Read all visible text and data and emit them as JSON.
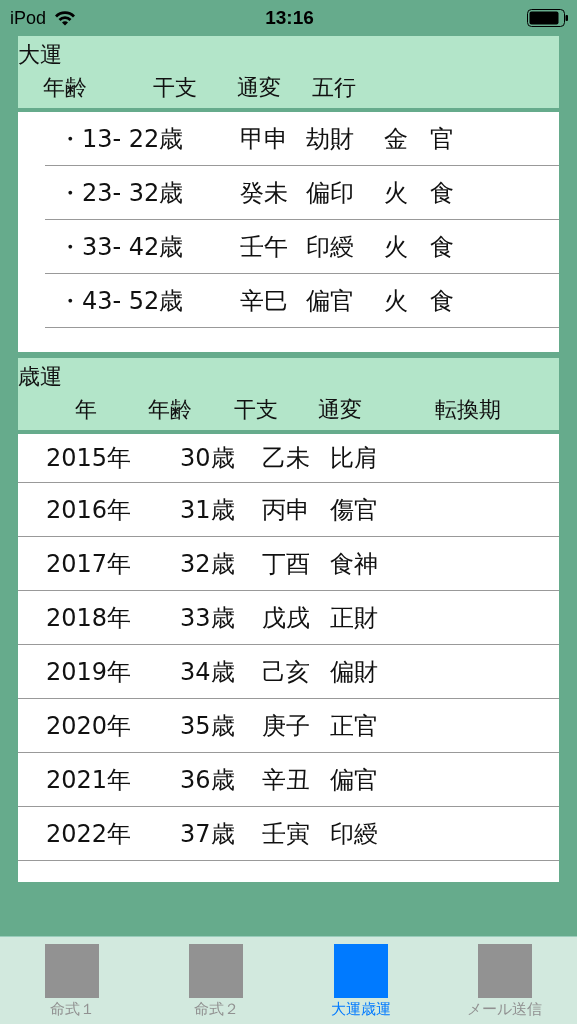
{
  "status_bar": {
    "device": "iPod",
    "time": "13:16"
  },
  "sections": [
    {
      "title": "大運",
      "columns": [
        "年齢",
        "干支",
        "通変",
        "五行"
      ],
      "rows": [
        {
          "cells": [
            "・",
            "13- 22歳",
            "甲申",
            "劫財",
            "金",
            "官"
          ]
        },
        {
          "cells": [
            "・",
            "23- 32歳",
            "癸未",
            "偏印",
            "火",
            "食"
          ]
        },
        {
          "cells": [
            "・",
            "33- 42歳",
            "壬午",
            "印綬",
            "火",
            "食"
          ]
        },
        {
          "cells": [
            "・",
            "43- 52歳",
            "辛巳",
            "偏官",
            "火",
            "食"
          ]
        }
      ]
    },
    {
      "title": "歳運",
      "columns": [
        "年",
        "年齢",
        "干支",
        "通変",
        "転換期"
      ],
      "rows": [
        {
          "cells": [
            "2015年",
            "30歳",
            "乙未",
            "比肩"
          ]
        },
        {
          "cells": [
            "2016年",
            "31歳",
            "丙申",
            "傷官"
          ]
        },
        {
          "cells": [
            "2017年",
            "32歳",
            "丁酉",
            "食神"
          ]
        },
        {
          "cells": [
            "2018年",
            "33歳",
            "戊戌",
            "正財"
          ]
        },
        {
          "cells": [
            "2019年",
            "34歳",
            "己亥",
            "偏財"
          ]
        },
        {
          "cells": [
            "2020年",
            "35歳",
            "庚子",
            "正官"
          ]
        },
        {
          "cells": [
            "2021年",
            "36歳",
            "辛丑",
            "偏官"
          ]
        },
        {
          "cells": [
            "2022年",
            "37歳",
            "壬寅",
            "印綬"
          ]
        }
      ]
    }
  ],
  "tabs": [
    {
      "label": "命式１",
      "selected": false
    },
    {
      "label": "命式２",
      "selected": false
    },
    {
      "label": "大運歳運",
      "selected": true
    },
    {
      "label": "メール送信",
      "selected": false
    }
  ]
}
